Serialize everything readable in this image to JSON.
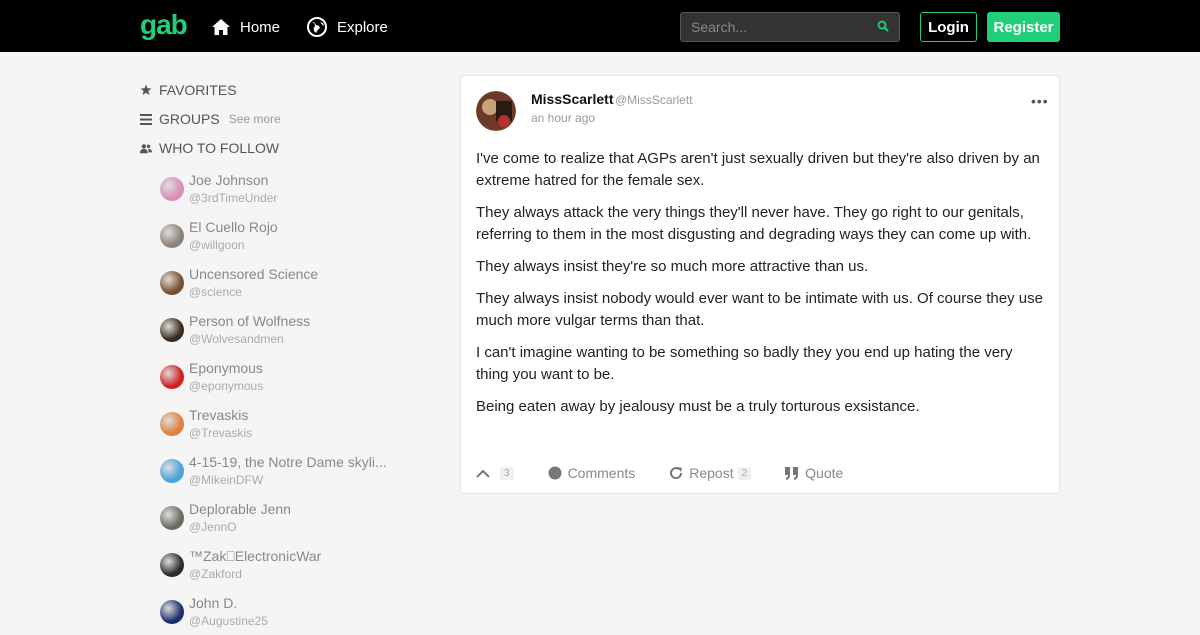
{
  "header": {
    "logo": "gab",
    "nav": [
      {
        "label": "Home",
        "icon": "home-icon"
      },
      {
        "label": "Explore",
        "icon": "globe-icon"
      }
    ],
    "search_placeholder": "Search...",
    "login_label": "Login",
    "register_label": "Register",
    "brand_color": "#21cf7a"
  },
  "sidebar": {
    "favorites_label": "FAVORITES",
    "groups_label": "GROUPS",
    "see_more_label": "See more",
    "who_to_follow_label": "WHO TO FOLLOW",
    "follow": [
      {
        "name": "Joe Johnson",
        "handle": "@3rdTimeUnder",
        "color": "#d98fb5"
      },
      {
        "name": "El Cuello Rojo",
        "handle": "@willgoon",
        "color": "#8a8378"
      },
      {
        "name": "Uncensored Science",
        "handle": "@science",
        "color": "#7a4e2e"
      },
      {
        "name": "Person of Wolfness",
        "handle": "@Wolvesandmen",
        "color": "#3b2a1c"
      },
      {
        "name": "Eponymous",
        "handle": "@eponymous",
        "color": "#d11f1f"
      },
      {
        "name": "Trevaskis",
        "handle": "@Trevaskis",
        "color": "#e0803a"
      },
      {
        "name": "4-15-19, the Notre Dame skyli...",
        "handle": "@MikeinDFW",
        "color": "#4aa3d9"
      },
      {
        "name": "Deplorable Jenn",
        "handle": "@JennO",
        "color": "#6b6b5e"
      },
      {
        "name": "™Zak⎕ElectronicWar",
        "handle": "@Zakford",
        "color": "#2b2b2b"
      },
      {
        "name": "John D.",
        "handle": "@Augustine25",
        "color": "#1c2f6b"
      }
    ]
  },
  "post": {
    "author_name": "MissScarlett",
    "author_handle": "@MissScarlett",
    "time": "an hour ago",
    "paragraphs": [
      "I've come to realize that AGPs aren't just sexually driven but they're also driven by an extreme hatred for the female sex.",
      "They always attack the very things they'll never have.  They go right to our genitals, referring to them in the most disgusting and degrading ways they can come up with.",
      "They always insist they're so much more attractive than us.",
      "They always insist nobody would ever want to be intimate with us.  Of course they use much more vulgar terms than that.",
      "I can't imagine wanting to be something so badly they you end up hating the very thing you want to be.",
      "Being eaten away by jealousy must be a truly torturous exsistance."
    ],
    "upvote_count": "3",
    "comments_label": "Comments",
    "repost_label": "Repost",
    "repost_count": "2",
    "quote_label": "Quote"
  }
}
